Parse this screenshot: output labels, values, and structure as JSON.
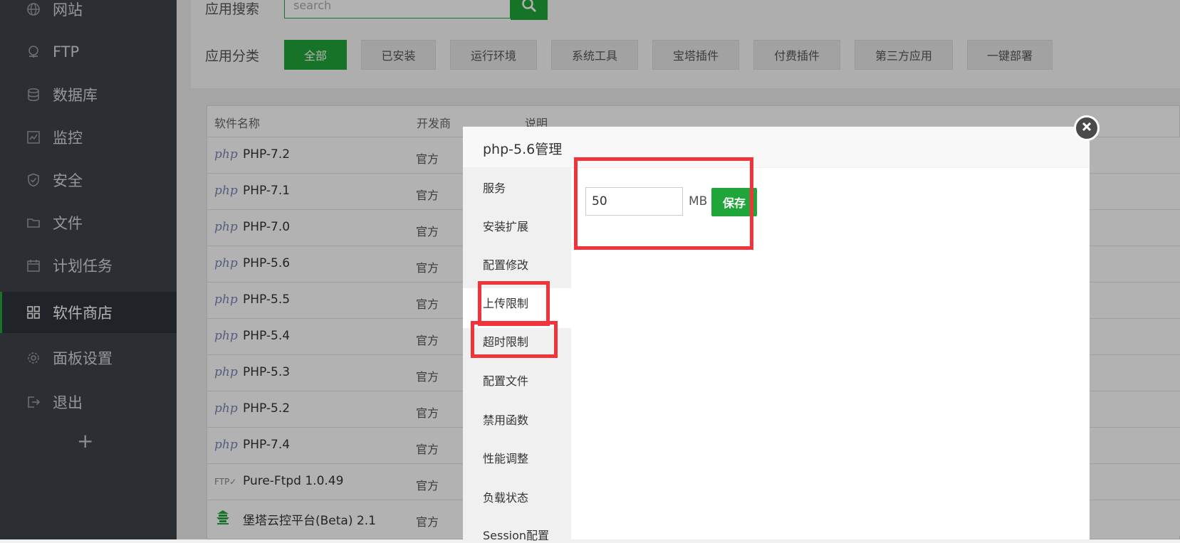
{
  "sidebar": {
    "items": [
      {
        "label": "网站",
        "icon": "globe-icon"
      },
      {
        "label": "FTP",
        "icon": "ftp-icon"
      },
      {
        "label": "数据库",
        "icon": "database-icon"
      },
      {
        "label": "监控",
        "icon": "monitor-icon"
      },
      {
        "label": "安全",
        "icon": "shield-icon"
      },
      {
        "label": "文件",
        "icon": "folder-icon"
      },
      {
        "label": "计划任务",
        "icon": "calendar-icon"
      },
      {
        "label": "软件商店",
        "icon": "grid-icon",
        "active": true
      },
      {
        "label": "面板设置",
        "icon": "gear-icon"
      },
      {
        "label": "退出",
        "icon": "logout-icon"
      }
    ],
    "add_label": "+"
  },
  "toolbar": {
    "search_label": "应用搜索",
    "search_placeholder": "search",
    "category_label": "应用分类",
    "categories": [
      "全部",
      "已安装",
      "运行环境",
      "系统工具",
      "宝塔插件",
      "付费插件",
      "第三方应用",
      "一键部署"
    ]
  },
  "table": {
    "headers": [
      "软件名称",
      "开发商",
      "说明"
    ],
    "rows": [
      {
        "logo": "php",
        "name": "PHP-7.2",
        "dev": "官方"
      },
      {
        "logo": "php",
        "name": "PHP-7.1",
        "dev": "官方"
      },
      {
        "logo": "php",
        "name": "PHP-7.0",
        "dev": "官方"
      },
      {
        "logo": "php",
        "name": "PHP-5.6",
        "dev": "官方"
      },
      {
        "logo": "php",
        "name": "PHP-5.5",
        "dev": "官方"
      },
      {
        "logo": "php",
        "name": "PHP-5.4",
        "dev": "官方"
      },
      {
        "logo": "php",
        "name": "PHP-5.3",
        "dev": "官方"
      },
      {
        "logo": "php",
        "name": "PHP-5.2",
        "dev": "官方"
      },
      {
        "logo": "php",
        "name": "PHP-7.4",
        "dev": "官方"
      },
      {
        "logo": "FTP✓",
        "name": "Pure-Ftpd 1.0.49",
        "dev": "官方"
      },
      {
        "logo": "",
        "name": "堡塔云控平台(Beta) 2.1",
        "dev": "官方"
      }
    ]
  },
  "modal": {
    "title": "php-5.6管理",
    "menu": [
      "服务",
      "安装扩展",
      "配置修改",
      "上传限制",
      "超时限制",
      "配置文件",
      "禁用函数",
      "性能调整",
      "负载状态",
      "Session配置"
    ],
    "active_menu": "上传限制",
    "upload_value": "50",
    "unit": "MB",
    "save_label": "保存"
  },
  "colors": {
    "accent": "#20a53a",
    "highlight": "#f0343a",
    "sidebar_bg": "#3e4349"
  }
}
